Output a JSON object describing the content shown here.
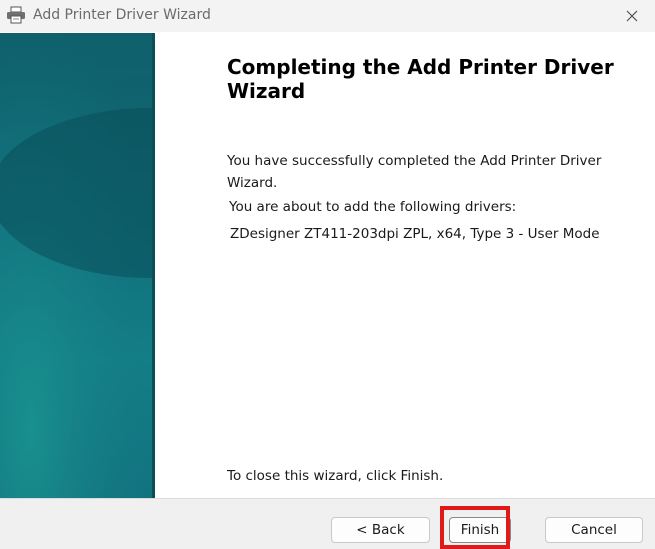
{
  "window": {
    "title": "Add Printer Driver Wizard",
    "icon": "printer-icon",
    "close_icon": "close-icon"
  },
  "content": {
    "heading": "Completing the Add Printer Driver Wizard",
    "success_text": "You have successfully completed the Add Printer Driver Wizard.",
    "about_text": "You are about to add the following drivers:",
    "driver": "ZDesigner ZT411-203dpi ZPL, x64, Type 3 - User Mode",
    "close_hint": "To close this wizard, click Finish."
  },
  "buttons": {
    "back": "< Back",
    "finish": "Finish",
    "cancel": "Cancel"
  },
  "colors": {
    "highlight": "#e01919",
    "banner": "#11707c"
  }
}
